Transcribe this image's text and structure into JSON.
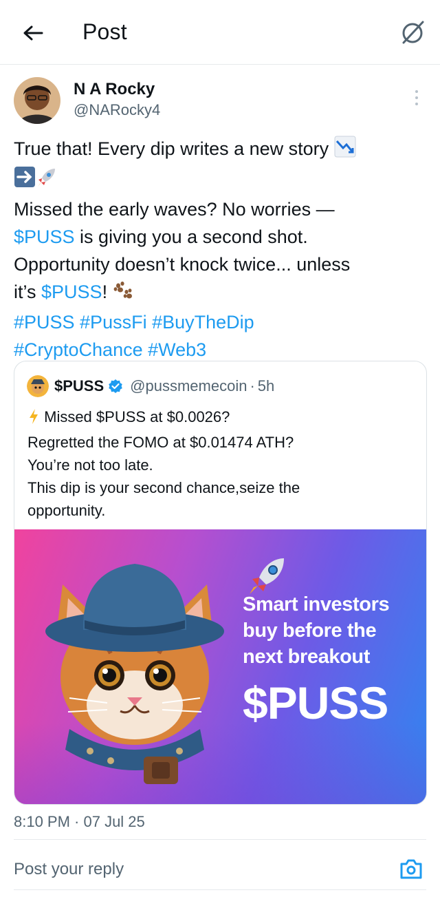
{
  "header": {
    "title": "Post",
    "back_icon": "arrow-left-icon",
    "grok_icon": "grok-icon"
  },
  "post": {
    "author_name": "N A Rocky",
    "author_handle": "@NARocky4",
    "lines": [
      {
        "text": "True that! Every dip writes a new story "
      },
      {
        "text": ""
      },
      {
        "text": "Missed the early waves? No worries —"
      },
      {
        "link": "$PUSS",
        "text": " is giving you a second shot."
      },
      {
        "text": "Opportunity doesn’t knock twice... unless"
      },
      {
        "pre": "it’s ",
        "link": "$PUSS",
        "text": "! "
      },
      {
        "link": "#PUSS #PussFi #BuyTheDip"
      },
      {
        "link": "#CryptoChance #Web3"
      }
    ],
    "timestamp": "8:10 PM · 07 Jul 25"
  },
  "quote": {
    "name": "$PUSS",
    "handle": "@pussmemecoin",
    "dot": "·",
    "time": "5h",
    "lines": [
      " Missed $PUSS at $0.0026?",
      "Regretted the FOMO at $0.01474 ATH?",
      "You’re not too late.",
      "This dip is your second chance,seize the",
      "opportunity."
    ],
    "media": {
      "headline_lines": [
        "Smart investors",
        "buy before the",
        "next breakout"
      ],
      "ticker": "$PUSS"
    }
  },
  "reply": {
    "placeholder": "Post your reply"
  },
  "colors": {
    "link": "#1d9bf0",
    "text": "#0f1419",
    "muted": "#536471",
    "verified": "#1d9bf0"
  }
}
